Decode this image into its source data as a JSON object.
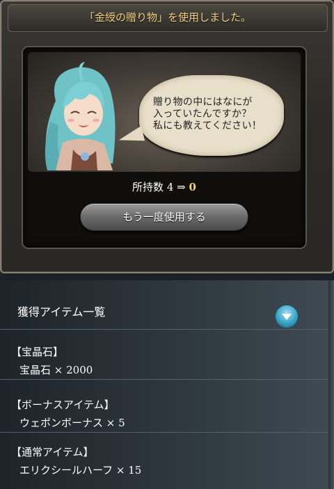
{
  "dialog": {
    "title": "「金綬の贈り物」を使用しました。",
    "speech": "贈り物の中にはなにが\n入っていたんですか？\n私にも教えてください！",
    "count": {
      "label": "所持数",
      "before": "4",
      "arrow": "⇒",
      "after": "0"
    },
    "reuse_label": "もう一度使用する"
  },
  "obtained": {
    "header": "獲得アイテム一覧",
    "groups": [
      {
        "category": "【宝晶石】",
        "item": "宝晶石 × 2000"
      },
      {
        "category": "【ボーナスアイテム】",
        "item": "ウェポンボーナス × 5"
      },
      {
        "category": "【通常アイテム】",
        "item": "エリクシールハーフ × 15"
      }
    ]
  },
  "colors": {
    "title_gold": "#f2d680",
    "count_highlight": "#f6d66a",
    "collapse_button": "#39a2c4"
  },
  "icons": {
    "collapse": "chevron-down-icon",
    "portrait": "character-portrait"
  }
}
